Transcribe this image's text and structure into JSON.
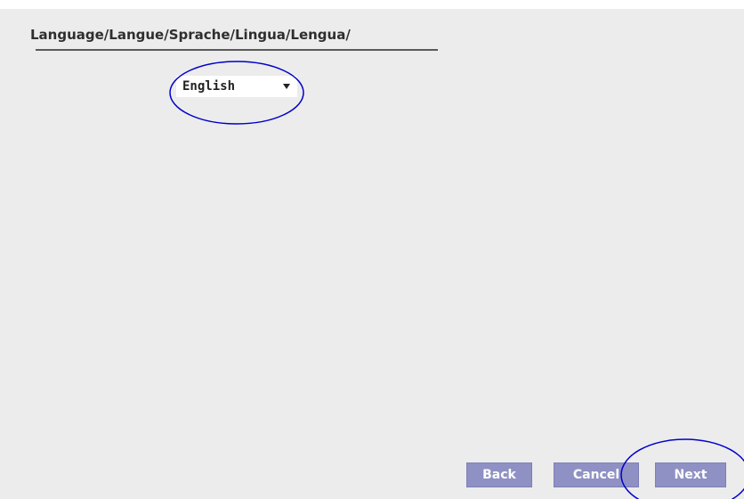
{
  "header": {
    "title": "Language/Langue/Sprache/Lingua/Lengua/"
  },
  "language_select": {
    "selected": "English",
    "icon": "dropdown-arrow-icon"
  },
  "buttons": {
    "back": "Back",
    "cancel": "Cancel",
    "next": "Next"
  },
  "colors": {
    "panel_bg": "#ececec",
    "button_bg": "#8f91c4",
    "annotation_outline": "#0000cc"
  }
}
